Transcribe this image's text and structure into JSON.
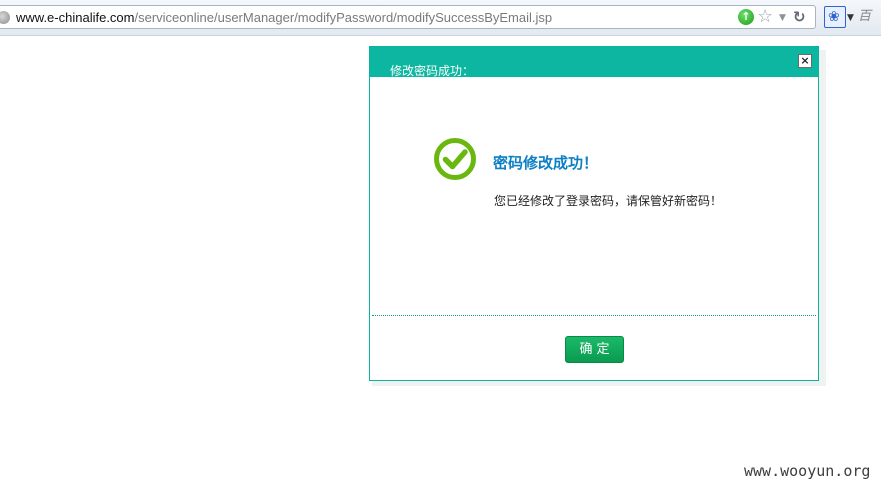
{
  "browser": {
    "url_domain": "www.e-chinalife.com",
    "url_path": "/serviceonline/userManager/modifyPassword/modifySuccessByEmail.jsp",
    "search_box_stub": "百"
  },
  "dialog": {
    "title": "修改密码成功：",
    "close_label": "×",
    "heading": "密码修改成功！",
    "message": "您已经修改了登录密码，请保管好新密码！",
    "confirm_label": "确定"
  },
  "watermark": "www.wooyun.org",
  "colors": {
    "header": "#0cb6a0",
    "heading_text": "#0c7fc5",
    "check": "#6ab80f",
    "confirm_button": "#0a9b4f"
  }
}
